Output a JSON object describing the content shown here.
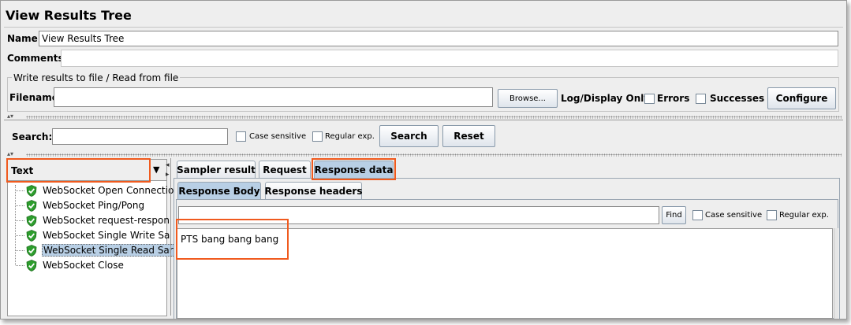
{
  "window": {
    "title": "View Results Tree"
  },
  "form": {
    "name_label": "Name:",
    "name_value": "View Results Tree",
    "comments_label": "Comments:",
    "comments_value": ""
  },
  "file_group": {
    "title": "Write results to file / Read from file",
    "filename_label": "Filename",
    "filename_value": "",
    "browse_label": "Browse...",
    "log_display_label": "Log/Display Only:",
    "errors_label": "Errors",
    "successes_label": "Successes",
    "configure_label": "Configure"
  },
  "search": {
    "label": "Search:",
    "value": "",
    "case_sensitive_label": "Case sensitive",
    "regex_label": "Regular exp.",
    "search_button": "Search",
    "reset_button": "Reset"
  },
  "renderer": {
    "selected": "Text"
  },
  "tree": {
    "items": [
      {
        "label": "WebSocket Open Connectio",
        "status": "success",
        "selected": false
      },
      {
        "label": "WebSocket Ping/Pong",
        "status": "success",
        "selected": false
      },
      {
        "label": "WebSocket request-respon",
        "status": "success",
        "selected": false
      },
      {
        "label": "WebSocket Single Write Sa",
        "status": "success",
        "selected": false
      },
      {
        "label": "WebSocket Single Read Sar",
        "status": "success",
        "selected": true
      },
      {
        "label": "WebSocket Close",
        "status": "success",
        "selected": false
      }
    ]
  },
  "tabs": {
    "top": [
      "Sampler result",
      "Request",
      "Response data"
    ],
    "top_selected": "Response data",
    "sub": [
      "Response Body",
      "Response headers"
    ],
    "sub_selected": "Response Body"
  },
  "response": {
    "find_value": "",
    "find_button": "Find",
    "case_sensitive_label": "Case sensitive",
    "regex_label": "Regular exp.",
    "body": "PTS bang bang bang"
  },
  "colors": {
    "highlight": "#f05a1e",
    "selection": "#b8cfe5",
    "panel": "#eeeeee",
    "success_icon": "#2e9e2e"
  }
}
